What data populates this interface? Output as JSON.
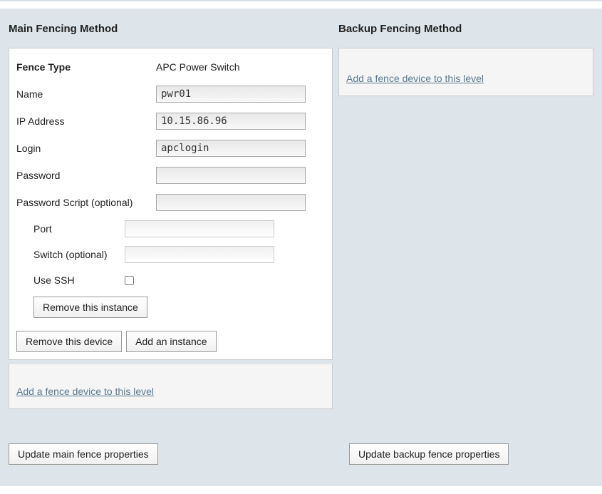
{
  "main": {
    "title": "Main Fencing Method",
    "fence_type_label": "Fence Type",
    "fence_type_value": "APC Power Switch",
    "name_label": "Name",
    "name_value": "pwr01",
    "ip_label": "IP Address",
    "ip_value": "10.15.86.96",
    "login_label": "Login",
    "login_value": "apclogin",
    "password_label": "Password",
    "password_value": "",
    "pwscript_label": "Password Script (optional)",
    "pwscript_value": "",
    "instance": {
      "port_label": "Port",
      "port_value": "",
      "switch_label": "Switch (optional)",
      "switch_value": "",
      "usessh_label": "Use SSH",
      "remove_instance_label": "Remove this instance"
    },
    "remove_device_label": "Remove this device",
    "add_instance_label": "Add an instance",
    "add_device_link": "Add a fence device to this level",
    "update_label": "Update main fence properties"
  },
  "backup": {
    "title": "Backup Fencing Method",
    "add_device_link": "Add a fence device to this level",
    "update_label": "Update backup fence properties"
  }
}
